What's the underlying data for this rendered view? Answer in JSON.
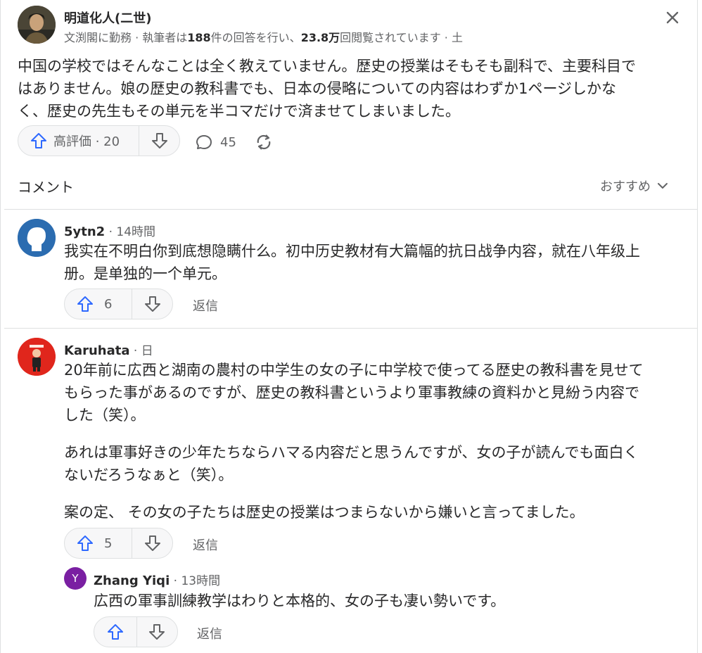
{
  "answer": {
    "author": "明道化人(二世)",
    "credential_prefix": "文渕閣に勤務 · 執筆者は",
    "answer_count": "188",
    "credential_mid": "件の回答を行い、",
    "view_count": "23.8万",
    "credential_suffix": "回閲覧されています · 土",
    "text_lines": [
      "中国の学校ではそんなことは全く教えていません。歴史の授業はそもそも副科で、主要科目で",
      "はありません。娘の歴史の教科書でも、日本の侵略についての内容はわずか1ページしかな",
      "く、歴史の先生もその単元を半コマだけで済ませてしまいました。"
    ],
    "upvote_label": "高評価 · 20",
    "comment_count": "45"
  },
  "comments_section": {
    "title": "コメント",
    "sort_label": "おすすめ"
  },
  "comments": [
    {
      "author": "5ytn2",
      "time": " · 14時間",
      "lines": [
        "我实在不明白你到底想隐瞒什么。初中历史教材有大篇幅的抗日战争内容，就在八年级上",
        "册。是单独的一个单元。"
      ],
      "votes": "6",
      "reply_label": "返信"
    },
    {
      "author": "Karuhata",
      "time": " · 日",
      "paragraphs": [
        [
          "20年前に広西と湖南の農村の中学生の女の子に中学校で使ってる歴史の教科書を見せて",
          "もらった事があるのですが、歴史の教科書というより軍事教練の資料かと見紛う内容で",
          "した（笑）。"
        ],
        [
          "あれは軍事好きの少年たちならハマる内容だと思うんですが、女の子が読んでも面白く",
          "ないだろうなぁと（笑）。"
        ],
        [
          "案の定、 その女の子たちは歴史の授業はつまらないから嫌いと言ってました。"
        ]
      ],
      "votes": "5",
      "reply_label": "返信"
    },
    {
      "author": "Zhang Yiqi",
      "avatar_letter": "Y",
      "time": " · 13時間",
      "lines": [
        "広西の軍事訓練教学はわりと本格的、女の子も凄い勢いです。"
      ],
      "reply_label": "返信"
    }
  ],
  "colors": {
    "upvote_blue": "#2e69ff",
    "muted": "#636466",
    "text": "#282829",
    "border": "#dee0e1",
    "avatar_blue": "#2b6cb0",
    "avatar_red": "#e0261c",
    "avatar_purple": "#7a1fa2"
  }
}
